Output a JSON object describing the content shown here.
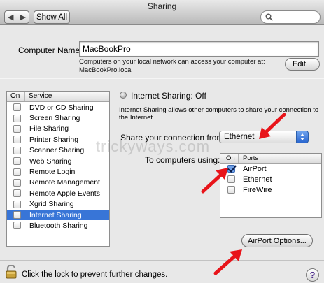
{
  "window": {
    "title": "Sharing"
  },
  "toolbar": {
    "back_glyph": "◀",
    "forward_glyph": "▶",
    "show_all_label": "Show All",
    "search_placeholder": ""
  },
  "computer_name": {
    "label": "Computer Name:",
    "value": "MacBookPro",
    "description_line1": "Computers on your local network can access your computer at:",
    "description_line2": "MacBookPro.local",
    "edit_label": "Edit..."
  },
  "services": {
    "header_on": "On",
    "header_service": "Service",
    "items": [
      {
        "label": "DVD or CD Sharing",
        "checked": false
      },
      {
        "label": "Screen Sharing",
        "checked": false
      },
      {
        "label": "File Sharing",
        "checked": false
      },
      {
        "label": "Printer Sharing",
        "checked": false
      },
      {
        "label": "Scanner Sharing",
        "checked": false
      },
      {
        "label": "Web Sharing",
        "checked": false
      },
      {
        "label": "Remote Login",
        "checked": false
      },
      {
        "label": "Remote Management",
        "checked": false
      },
      {
        "label": "Remote Apple Events",
        "checked": false
      },
      {
        "label": "Xgrid Sharing",
        "checked": false
      },
      {
        "label": "Internet Sharing",
        "checked": false,
        "selected": true
      },
      {
        "label": "Bluetooth Sharing",
        "checked": false
      }
    ]
  },
  "internet_sharing": {
    "status": "Internet Sharing: Off",
    "description": "Internet Sharing allows other computers to share your connection to the Internet.",
    "share_from_label": "Share your connection from:",
    "share_from_value": "Ethernet",
    "to_computers_label": "To computers using:",
    "ports_header_on": "On",
    "ports_header_ports": "Ports",
    "ports": [
      {
        "label": "AirPort",
        "checked": true
      },
      {
        "label": "Ethernet",
        "checked": false
      },
      {
        "label": "FireWire",
        "checked": false
      }
    ],
    "airport_options_label": "AirPort Options..."
  },
  "footer": {
    "lock_text": "Click the lock to prevent further changes.",
    "help_glyph": "?"
  },
  "watermark": "trickyways.com",
  "colors": {
    "selection": "#3875d7",
    "annotation_arrow": "#e8141a"
  }
}
